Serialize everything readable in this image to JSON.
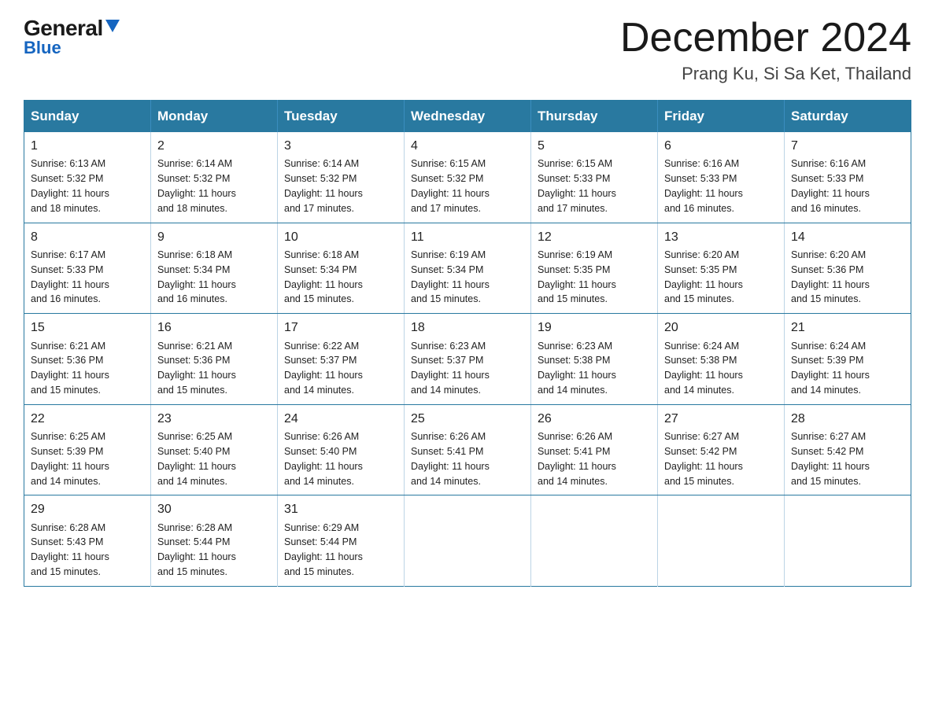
{
  "logo": {
    "general": "General",
    "blue": "Blue"
  },
  "header": {
    "month": "December 2024",
    "location": "Prang Ku, Si Sa Ket, Thailand"
  },
  "weekdays": [
    "Sunday",
    "Monday",
    "Tuesday",
    "Wednesday",
    "Thursday",
    "Friday",
    "Saturday"
  ],
  "weeks": [
    [
      {
        "day": "1",
        "sunrise": "6:13 AM",
        "sunset": "5:32 PM",
        "daylight": "11 hours and 18 minutes."
      },
      {
        "day": "2",
        "sunrise": "6:14 AM",
        "sunset": "5:32 PM",
        "daylight": "11 hours and 18 minutes."
      },
      {
        "day": "3",
        "sunrise": "6:14 AM",
        "sunset": "5:32 PM",
        "daylight": "11 hours and 17 minutes."
      },
      {
        "day": "4",
        "sunrise": "6:15 AM",
        "sunset": "5:32 PM",
        "daylight": "11 hours and 17 minutes."
      },
      {
        "day": "5",
        "sunrise": "6:15 AM",
        "sunset": "5:33 PM",
        "daylight": "11 hours and 17 minutes."
      },
      {
        "day": "6",
        "sunrise": "6:16 AM",
        "sunset": "5:33 PM",
        "daylight": "11 hours and 16 minutes."
      },
      {
        "day": "7",
        "sunrise": "6:16 AM",
        "sunset": "5:33 PM",
        "daylight": "11 hours and 16 minutes."
      }
    ],
    [
      {
        "day": "8",
        "sunrise": "6:17 AM",
        "sunset": "5:33 PM",
        "daylight": "11 hours and 16 minutes."
      },
      {
        "day": "9",
        "sunrise": "6:18 AM",
        "sunset": "5:34 PM",
        "daylight": "11 hours and 16 minutes."
      },
      {
        "day": "10",
        "sunrise": "6:18 AM",
        "sunset": "5:34 PM",
        "daylight": "11 hours and 15 minutes."
      },
      {
        "day": "11",
        "sunrise": "6:19 AM",
        "sunset": "5:34 PM",
        "daylight": "11 hours and 15 minutes."
      },
      {
        "day": "12",
        "sunrise": "6:19 AM",
        "sunset": "5:35 PM",
        "daylight": "11 hours and 15 minutes."
      },
      {
        "day": "13",
        "sunrise": "6:20 AM",
        "sunset": "5:35 PM",
        "daylight": "11 hours and 15 minutes."
      },
      {
        "day": "14",
        "sunrise": "6:20 AM",
        "sunset": "5:36 PM",
        "daylight": "11 hours and 15 minutes."
      }
    ],
    [
      {
        "day": "15",
        "sunrise": "6:21 AM",
        "sunset": "5:36 PM",
        "daylight": "11 hours and 15 minutes."
      },
      {
        "day": "16",
        "sunrise": "6:21 AM",
        "sunset": "5:36 PM",
        "daylight": "11 hours and 15 minutes."
      },
      {
        "day": "17",
        "sunrise": "6:22 AM",
        "sunset": "5:37 PM",
        "daylight": "11 hours and 14 minutes."
      },
      {
        "day": "18",
        "sunrise": "6:23 AM",
        "sunset": "5:37 PM",
        "daylight": "11 hours and 14 minutes."
      },
      {
        "day": "19",
        "sunrise": "6:23 AM",
        "sunset": "5:38 PM",
        "daylight": "11 hours and 14 minutes."
      },
      {
        "day": "20",
        "sunrise": "6:24 AM",
        "sunset": "5:38 PM",
        "daylight": "11 hours and 14 minutes."
      },
      {
        "day": "21",
        "sunrise": "6:24 AM",
        "sunset": "5:39 PM",
        "daylight": "11 hours and 14 minutes."
      }
    ],
    [
      {
        "day": "22",
        "sunrise": "6:25 AM",
        "sunset": "5:39 PM",
        "daylight": "11 hours and 14 minutes."
      },
      {
        "day": "23",
        "sunrise": "6:25 AM",
        "sunset": "5:40 PM",
        "daylight": "11 hours and 14 minutes."
      },
      {
        "day": "24",
        "sunrise": "6:26 AM",
        "sunset": "5:40 PM",
        "daylight": "11 hours and 14 minutes."
      },
      {
        "day": "25",
        "sunrise": "6:26 AM",
        "sunset": "5:41 PM",
        "daylight": "11 hours and 14 minutes."
      },
      {
        "day": "26",
        "sunrise": "6:26 AM",
        "sunset": "5:41 PM",
        "daylight": "11 hours and 14 minutes."
      },
      {
        "day": "27",
        "sunrise": "6:27 AM",
        "sunset": "5:42 PM",
        "daylight": "11 hours and 15 minutes."
      },
      {
        "day": "28",
        "sunrise": "6:27 AM",
        "sunset": "5:42 PM",
        "daylight": "11 hours and 15 minutes."
      }
    ],
    [
      {
        "day": "29",
        "sunrise": "6:28 AM",
        "sunset": "5:43 PM",
        "daylight": "11 hours and 15 minutes."
      },
      {
        "day": "30",
        "sunrise": "6:28 AM",
        "sunset": "5:44 PM",
        "daylight": "11 hours and 15 minutes."
      },
      {
        "day": "31",
        "sunrise": "6:29 AM",
        "sunset": "5:44 PM",
        "daylight": "11 hours and 15 minutes."
      },
      null,
      null,
      null,
      null
    ]
  ],
  "labels": {
    "sunrise": "Sunrise:",
    "sunset": "Sunset:",
    "daylight": "Daylight:"
  }
}
